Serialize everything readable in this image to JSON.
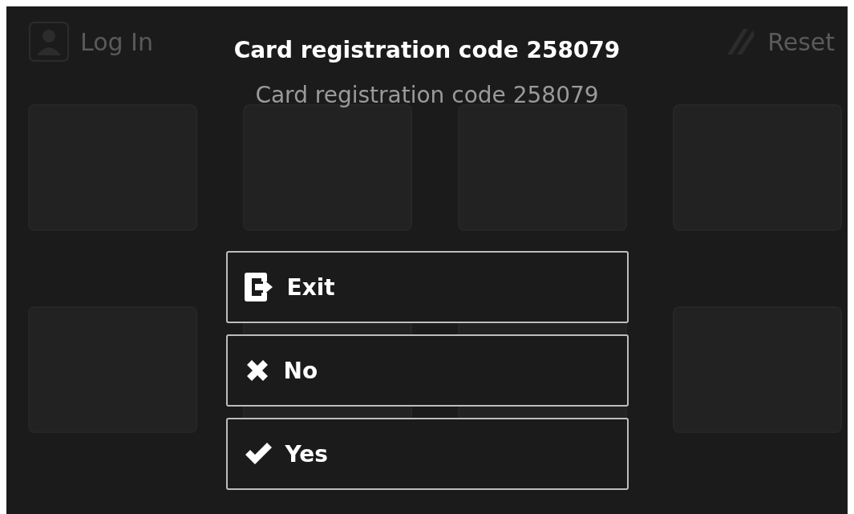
{
  "top_bar": {
    "login": "Log In",
    "reset": "Reset"
  },
  "dialog": {
    "title": "Card registration code 258079",
    "message": "Card registration code 258079",
    "buttons": [
      {
        "kind": "exit",
        "label": "Exit"
      },
      {
        "kind": "no",
        "label": "No"
      },
      {
        "kind": "yes",
        "label": "Yes"
      }
    ]
  }
}
